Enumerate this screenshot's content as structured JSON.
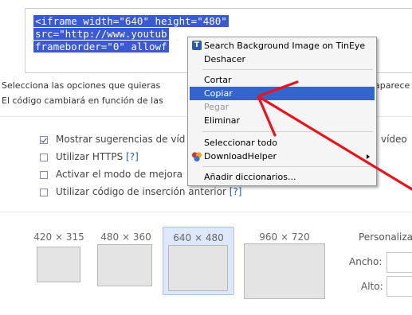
{
  "embed_code": {
    "lines": [
      "<iframe width=\"640\" height=\"480\"",
      "src=\"http://www.youtub",
      "frameborder=\"0\" allowf"
    ]
  },
  "description": {
    "line1_start": "Selecciona las opciones que quieras",
    "line1_end": "aparece",
    "line2_start": "El código cambiará en función de las"
  },
  "options": [
    {
      "label": "Mostrar sugerencias de víd",
      "label_end": "vídeo",
      "checked": true
    },
    {
      "label": "Utilizar HTTPS",
      "help": "[?]",
      "checked": false
    },
    {
      "label": "Activar el modo de mejora",
      "checked": false
    },
    {
      "label": "Utilizar código de inserción anterior",
      "help": "[?]",
      "checked": false
    }
  ],
  "sizes": [
    {
      "label": "420 × 315",
      "selected": false
    },
    {
      "label": "480 × 360",
      "selected": false
    },
    {
      "label": "640 × 480",
      "selected": true
    },
    {
      "label": "960 × 720",
      "selected": false
    }
  ],
  "custom_size": {
    "heading": "Personaliza",
    "width_label": "Ancho:",
    "height_label": "Alto:"
  },
  "context_menu": {
    "items": {
      "tineye": {
        "label": "Search Background Image on TinEye",
        "icon": "tineye-icon"
      },
      "undo": {
        "label": "Deshacer"
      },
      "cut": {
        "label": "Cortar"
      },
      "copy": {
        "label": "Copiar",
        "highlighted": true
      },
      "paste": {
        "label": "Pegar",
        "disabled": true
      },
      "delete": {
        "label": "Eliminar"
      },
      "select_all": {
        "label": "Seleccionar todo"
      },
      "downloadhelper": {
        "label": "DownloadHelper",
        "icon": "downloadhelper-icon",
        "has_submenu": true
      },
      "dictionaries": {
        "label": "Añadir diccionarios..."
      }
    }
  },
  "colors": {
    "selection": "#3a59d3",
    "menu_highlight": "#3366cc",
    "annotation_arrow": "#e8141a",
    "size_selected_bg": "#dde9fb"
  }
}
